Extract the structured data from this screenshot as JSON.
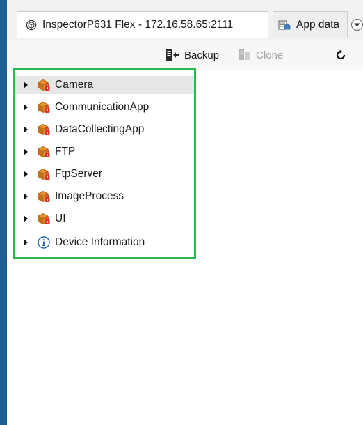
{
  "tabs": [
    {
      "label": "InspectorP631 Flex - 172.16.58.65:2111",
      "icon": "device-cube-icon",
      "active": true
    },
    {
      "label": "App data",
      "icon": "app-data-icon",
      "active": false
    }
  ],
  "toolbar": {
    "backup_label": "Backup",
    "clone_label": "Clone",
    "refresh_icon": "refresh-icon"
  },
  "tree": {
    "items": [
      {
        "label": "Camera",
        "icon": "app-package-lock-icon",
        "selected": true
      },
      {
        "label": "CommunicationApp",
        "icon": "app-package-lock-icon"
      },
      {
        "label": "DataCollectingApp",
        "icon": "app-package-lock-icon"
      },
      {
        "label": "FTP",
        "icon": "app-package-lock-icon"
      },
      {
        "label": "FtpServer",
        "icon": "app-package-lock-icon"
      },
      {
        "label": "ImageProcess",
        "icon": "app-package-lock-icon"
      },
      {
        "label": "UI",
        "icon": "app-package-lock-icon"
      },
      {
        "label": "Device Information",
        "icon": "info-icon"
      }
    ]
  },
  "colors": {
    "highlight_border": "#2db84d",
    "window_edge": "#1d5f93",
    "package_orange": "#e8922e",
    "lock_red": "#d9372b"
  }
}
